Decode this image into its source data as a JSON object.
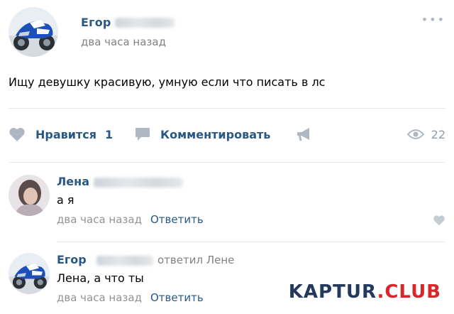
{
  "post": {
    "author_name": "Егор",
    "time": "два часа назад",
    "menu_icon": "more-dots-icon",
    "text": "Ищу девушку красивую, умную если что писать в лс"
  },
  "actions": {
    "like_icon": "heart-icon",
    "like_label": "Нравится",
    "like_count": "1",
    "comment_icon": "speech-bubble-icon",
    "comment_label": "Комментировать",
    "share_icon": "megaphone-icon",
    "views_icon": "eye-icon",
    "views_count": "22"
  },
  "comments": [
    {
      "author": "Лена",
      "text": "а я",
      "time": "два часа назад",
      "reply_label": "Ответить"
    },
    {
      "author": "Егор",
      "reply_to": "ответил Лене",
      "text": "Лена, а что ты",
      "time": "два часа назад",
      "reply_label": "Ответить"
    }
  ],
  "watermark": {
    "part1": "KAPTUR",
    "part2": ".CLUB"
  },
  "colors": {
    "link": "#2a5885",
    "meta": "#828282",
    "icon": "#aeb7c2",
    "divider": "#e7e8ec",
    "watermark_dark": "#233a5e",
    "watermark_red": "#d8262a"
  }
}
